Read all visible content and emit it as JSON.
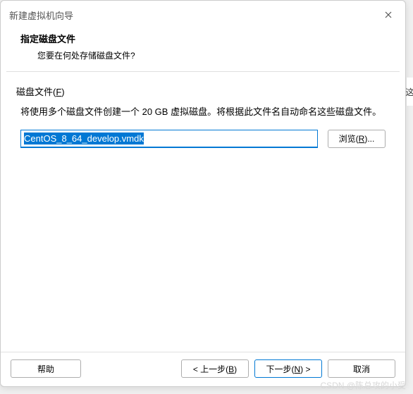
{
  "titlebar": {
    "title": "新建虚拟机向导"
  },
  "header": {
    "title": "指定磁盘文件",
    "subtitle": "您要在何处存储磁盘文件?"
  },
  "group": {
    "label_prefix": "磁盘文件(",
    "label_key": "F",
    "label_suffix": ")"
  },
  "description": "将使用多个磁盘文件创建一个 20 GB 虚拟磁盘。将根据此文件名自动命名这些磁盘文件。",
  "input": {
    "value": "CentOS_8_64_develop.vmdk"
  },
  "buttons": {
    "browse_prefix": "浏览(",
    "browse_key": "R",
    "browse_suffix": ")...",
    "help": "帮助",
    "back_prefix": "< 上一步(",
    "back_key": "B",
    "back_suffix": ")",
    "next_prefix": "下一步(",
    "next_key": "N",
    "next_suffix": ") >",
    "cancel": "取消"
  },
  "watermark": "CSDN @陈总攻的小受",
  "side_char": "这"
}
